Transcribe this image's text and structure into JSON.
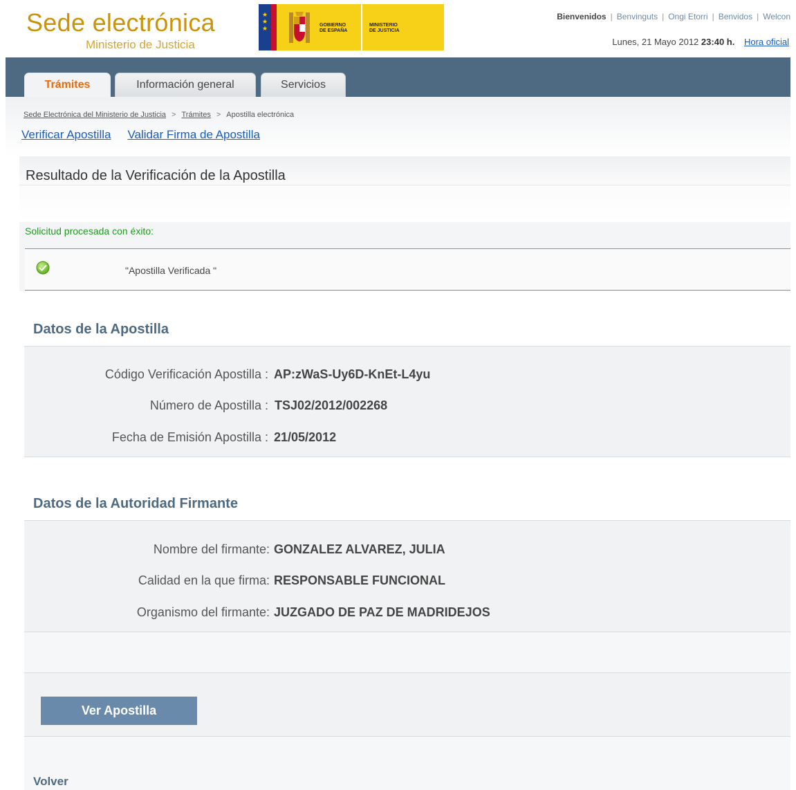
{
  "header": {
    "brand_title": "Sede electrónica",
    "brand_subtitle": "Ministerio de Justicia",
    "gov_logo_left": "GOBIERNO\nDE ESPAÑA",
    "gov_logo_right": "MINISTERIO\nDE JUSTICIA",
    "languages": [
      "Bienvenidos",
      "Benvinguts",
      "Ongi Etorri",
      "Benvidos",
      "Welcon"
    ],
    "date": "Lunes, 21 Mayo 2012",
    "time": "23:40 h.",
    "official_time_link": "Hora oficial"
  },
  "nav": {
    "tabs": [
      {
        "label": "Trámites",
        "active": true
      },
      {
        "label": "Información general",
        "active": false
      },
      {
        "label": "Servicios",
        "active": false
      }
    ]
  },
  "breadcrumb": {
    "items": [
      "Sede Electrónica del Ministerio de Justicia",
      "Trámites",
      "Apostilla electrónica"
    ],
    "separator": ">"
  },
  "sublinks": [
    "Verificar Apostilla",
    "Validar Firma de Apostilla"
  ],
  "result": {
    "title": "Resultado de la Verificación de la Apostilla",
    "success_message": "Solicitud procesada con éxito:",
    "status_text": "\"Apostilla Verificada \""
  },
  "apostilla": {
    "title": "Datos de la Apostilla",
    "rows": [
      {
        "label": "Código Verificación Apostilla :",
        "value": "AP:zWaS-Uy6D-KnEt-L4yu"
      },
      {
        "label": "Número de Apostilla :",
        "value": "TSJ02/2012/002268"
      },
      {
        "label": "Fecha de Emisión Apostilla :",
        "value": "21/05/2012"
      }
    ]
  },
  "authority": {
    "title": "Datos de la Autoridad Firmante",
    "rows": [
      {
        "label": "Nombre del firmante:",
        "value": "GONZALEZ ALVAREZ, JULIA"
      },
      {
        "label": "Calidad en la que firma:",
        "value": "RESPONSABLE FUNCIONAL"
      },
      {
        "label": "Organismo del firmante:",
        "value": "JUZGADO DE PAZ DE MADRIDEJOS"
      }
    ]
  },
  "actions": {
    "view_button": "Ver Apostilla",
    "back_link": "Volver"
  },
  "colors": {
    "brand": "#c9930a",
    "nav_band": "#4e6a82",
    "active_tab": "#e66b0c",
    "success": "#1e9a1e",
    "link": "#1a5bbf",
    "button": "#6a8aab"
  }
}
